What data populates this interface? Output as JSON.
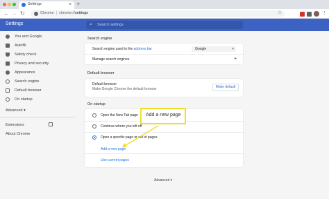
{
  "browser": {
    "tab_title": "Settings",
    "tab_close": "×",
    "new_tab": "+",
    "back": "←",
    "forward": "→",
    "reload": "↻",
    "omnibox_chip": "Chrome",
    "omnibox_sep": "|",
    "omnibox_scheme": "chrome://",
    "omnibox_path": "settings",
    "star": "☆",
    "menu": "⋮"
  },
  "header": {
    "title": "Settings",
    "search_placeholder": "Search settings",
    "search_icon": "⌕"
  },
  "sidebar": {
    "items": [
      {
        "label": "You and Google",
        "icon": "person-icon"
      },
      {
        "label": "Autofill",
        "icon": "clipboard-icon"
      },
      {
        "label": "Safety check",
        "icon": "shield-icon"
      },
      {
        "label": "Privacy and security",
        "icon": "lock-icon"
      },
      {
        "label": "Appearance",
        "icon": "palette-icon"
      },
      {
        "label": "Search engine",
        "icon": "search-icon"
      },
      {
        "label": "Default browser",
        "icon": "browser-icon"
      },
      {
        "label": "On startup",
        "icon": "power-icon"
      }
    ],
    "advanced": "Advanced",
    "advanced_caret": "▾",
    "extensions": "Extensions",
    "about": "About Chrome"
  },
  "search_engine": {
    "title": "Search engine",
    "row1_prefix": "Search engine used in the ",
    "row1_link": "address bar",
    "selected": "Google",
    "caret": "▾",
    "row2": "Manage search engines",
    "chevron": "▸"
  },
  "default_browser": {
    "title": "Default browser",
    "label": "Default browser",
    "sub": "Make Google Chrome the default browser",
    "button": "Make default"
  },
  "on_startup": {
    "title": "On startup",
    "options": [
      {
        "label": "Open the New Tab page",
        "selected": false
      },
      {
        "label": "Continue where you left off",
        "selected": false
      },
      {
        "label": "Open a specific page or set of pages",
        "selected": true
      }
    ],
    "add_page": "Add a new page",
    "use_current": "Use current pages"
  },
  "bottom_advanced": "Advanced",
  "bottom_caret": "▾",
  "callout": {
    "text": "Add a new page"
  },
  "colors": {
    "header": "#3c62c4",
    "accent": "#1a73e8",
    "callout_border": "#f2de2a"
  }
}
